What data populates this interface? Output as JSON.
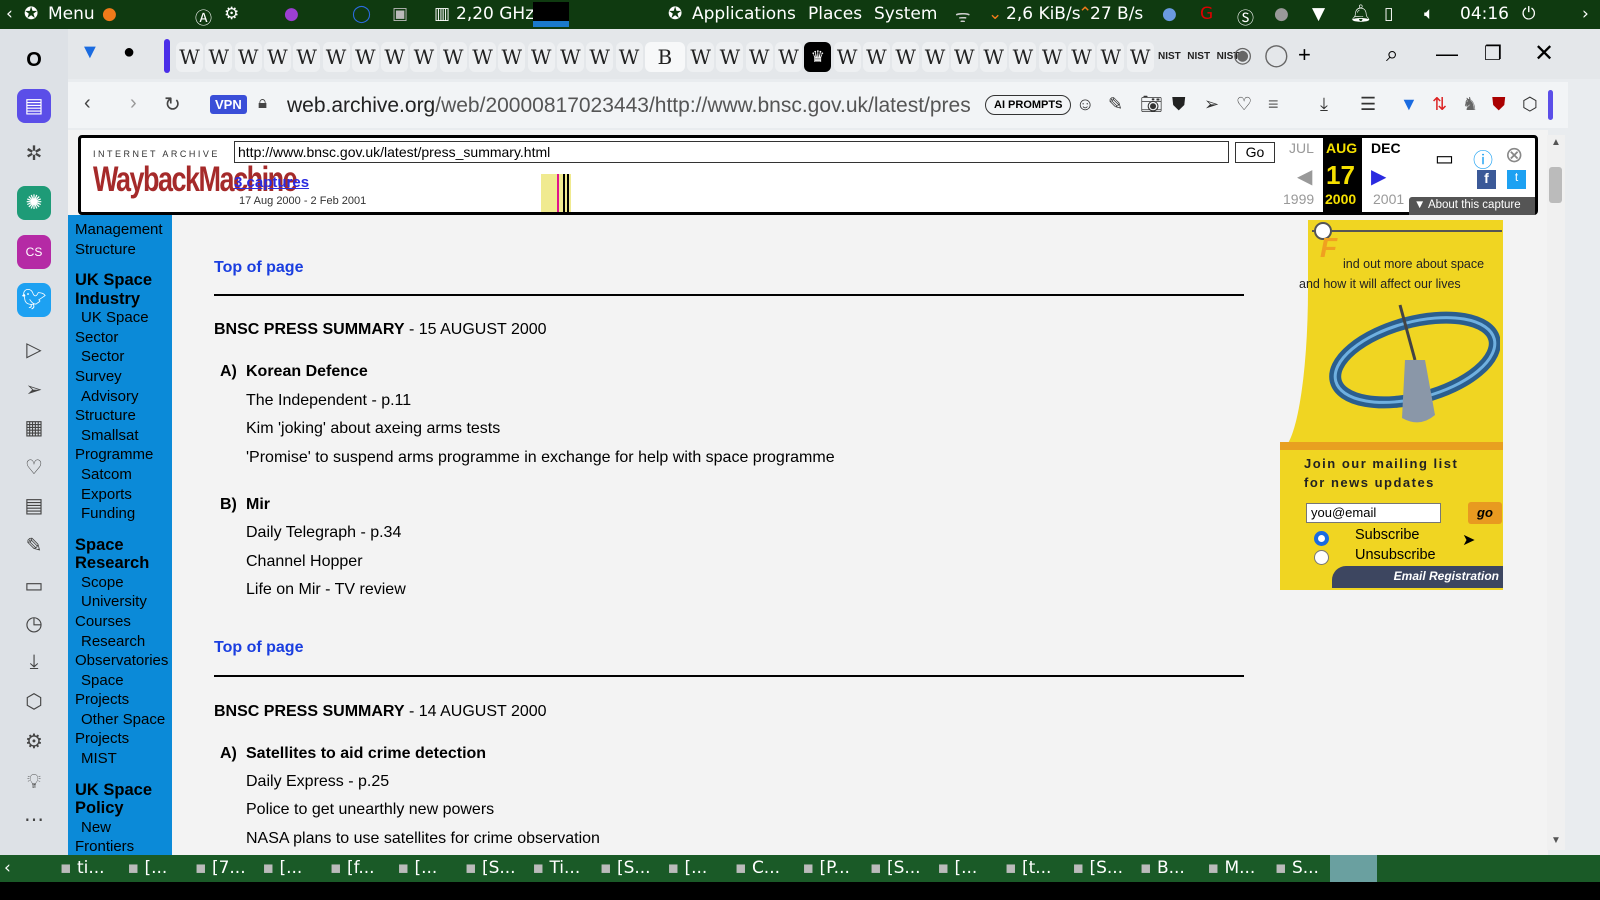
{
  "panel": {
    "menu": "Menu",
    "cpu": "2,20 GHz",
    "applications": "Applications",
    "places": "Places",
    "system": "System",
    "net_down": "2,6 KiB/s",
    "net_up": "27 B/s",
    "clock": "04:16"
  },
  "tabs": [
    "W",
    "W",
    "W",
    "W",
    "W",
    "W",
    "W",
    "W",
    "W",
    "W",
    "W",
    "W",
    "W",
    "W",
    "W",
    "W",
    "B",
    "W",
    "W",
    "W",
    "W",
    "♛",
    "W",
    "W",
    "W",
    "W",
    "W",
    "W",
    "W",
    "W",
    "W",
    "W",
    "W",
    "NIST",
    "NIST",
    "NIST"
  ],
  "address": {
    "vpn": "VPN",
    "url_host": "web.archive.org",
    "url_path": "/web/20000817023443/http://www.bnsc.gov.uk/latest/pres",
    "ai_prompts": "AI PROMPTS"
  },
  "wayback": {
    "logo_top": "INTERNET ARCHIVE",
    "logo": "WaybackMachine",
    "url": "http://www.bnsc.gov.uk/latest/press_summary.html",
    "go": "Go",
    "captures": "3 captures",
    "range": "17 Aug 2000 - 2 Feb 2001",
    "prev_month": "JUL",
    "cur_month": "AUG",
    "next_month": "DEC",
    "day": "17",
    "prev_year": "1999",
    "cur_year": "2000",
    "next_year": "2001",
    "about": "About this capture"
  },
  "nav": [
    {
      "t": "Management",
      "c": "i0"
    },
    {
      "t": "Structure",
      "c": ""
    },
    {
      "t": "UK Space Industry",
      "c": "h"
    },
    {
      "t": "UK Space",
      "c": "i"
    },
    {
      "t": "Sector",
      "c": ""
    },
    {
      "t": "Sector",
      "c": "i"
    },
    {
      "t": "Survey",
      "c": ""
    },
    {
      "t": "Advisory",
      "c": "i"
    },
    {
      "t": "Structure",
      "c": ""
    },
    {
      "t": "Smallsat",
      "c": "i"
    },
    {
      "t": "Programme",
      "c": ""
    },
    {
      "t": "Satcom",
      "c": "i"
    },
    {
      "t": "Exports",
      "c": "i"
    },
    {
      "t": "Funding",
      "c": "i"
    },
    {
      "t": "Space Research",
      "c": "h"
    },
    {
      "t": "Scope",
      "c": "i"
    },
    {
      "t": "University",
      "c": "i"
    },
    {
      "t": "Courses",
      "c": ""
    },
    {
      "t": "Research",
      "c": "i"
    },
    {
      "t": "Observatories",
      "c": ""
    },
    {
      "t": "Space",
      "c": "i"
    },
    {
      "t": "Projects",
      "c": ""
    },
    {
      "t": "Other Space",
      "c": "i"
    },
    {
      "t": "Projects",
      "c": ""
    },
    {
      "t": "MIST",
      "c": "i"
    },
    {
      "t": "UK Space Policy",
      "c": "h"
    },
    {
      "t": "New",
      "c": "i"
    },
    {
      "t": "Frontiers",
      "c": ""
    }
  ],
  "main": {
    "top_of_page": "Top of page",
    "s1": {
      "title": "BNSC PRESS SUMMARY",
      "date": " - 15 AUGUST 2000",
      "a_label": "A)",
      "a_title": "Korean Defence",
      "a_items": [
        "The Independent - p.11",
        "Kim 'joking' about axeing arms tests",
        "'Promise' to suspend arms programme in exchange for help with space programme"
      ],
      "b_label": "B)",
      "b_title": "Mir",
      "b_items": [
        "Daily Telegraph - p.34",
        "Channel Hopper",
        "Life on Mir - TV review"
      ]
    },
    "s2": {
      "title": "BNSC PRESS SUMMARY",
      "date": " - 14 AUGUST 2000",
      "a_label": "A)",
      "a_title": "Satellites to aid crime detection",
      "a_items": [
        "Daily Express - p.25",
        "Police to get unearthly new powers",
        "NASA plans to use satellites for crime observation"
      ]
    }
  },
  "ad": {
    "line1": "ind out more about space",
    "line2": "and how it will affect our lives",
    "join1": "Join our mailing list",
    "join2": "for news updates",
    "email_value": "you@email",
    "go": "go",
    "subscribe": "Subscribe",
    "unsubscribe": "Unsubscribe",
    "footer": "Email Registration"
  },
  "taskbar": [
    "ti...",
    "[...",
    "[7...",
    "[...",
    "[f...",
    "[...",
    "[S...",
    "Ti...",
    "[S...",
    "[...",
    "C...",
    "[P...",
    "[S...",
    "[...",
    "[t...",
    "[S...",
    "B...",
    "M...",
    "S..."
  ]
}
